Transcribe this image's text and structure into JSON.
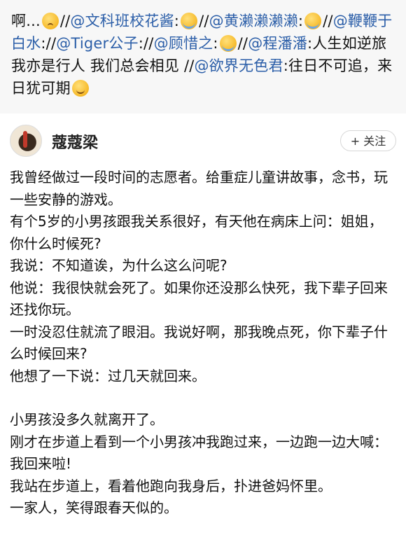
{
  "repost": {
    "prefix": "啊...",
    "segments": [
      {
        "type": "emoji",
        "name": "sad-emoji"
      },
      {
        "type": "text",
        "text": "//"
      },
      {
        "type": "mention",
        "text": "@文科班校花酱"
      },
      {
        "type": "text",
        "text": ":"
      },
      {
        "type": "emoji",
        "name": "crying-emoji"
      },
      {
        "type": "text",
        "text": "//"
      },
      {
        "type": "mention",
        "text": "@黄濑濑濑濑"
      },
      {
        "type": "text",
        "text": ":"
      },
      {
        "type": "emoji",
        "name": "crying-emoji"
      },
      {
        "type": "text",
        "text": "//"
      },
      {
        "type": "mention",
        "text": "@鞭鞭于白水"
      },
      {
        "type": "text",
        "text": "://"
      },
      {
        "type": "mention",
        "text": "@Tiger公子"
      },
      {
        "type": "text",
        "text": "://"
      },
      {
        "type": "mention",
        "text": "@顾惜之"
      },
      {
        "type": "text",
        "text": ":"
      },
      {
        "type": "emoji",
        "name": "crying-emoji"
      },
      {
        "type": "text",
        "text": "//"
      },
      {
        "type": "mention",
        "text": "@程潘潘"
      },
      {
        "type": "text",
        "text": ":人生如逆旅 我亦是行人 我们总会相见 //"
      },
      {
        "type": "mention",
        "text": "@欲界无色君"
      },
      {
        "type": "text",
        "text": ":往日不可追，来日犹可期"
      },
      {
        "type": "emoji",
        "name": "smile-emoji"
      }
    ]
  },
  "post": {
    "username": "蔻蔻梁",
    "follow_label": "+ 关注",
    "paragraphs": [
      "我曾经做过一段时间的志愿者。给重症儿童讲故事，念书，玩一些安静的游戏。",
      "有个5岁的小男孩跟我关系很好，有天他在病床上问：姐姐，你什么时候死?",
      "我说：不知道诶，为什么这么问呢?",
      "他说：我很快就会死了。如果你还没那么快死，我下辈子回来还找你玩。",
      "一时没忍住就流了眼泪。我说好啊，那我晚点死，你下辈子什么时候回来?",
      "他想了一下说：过几天就回来。",
      "",
      "小男孩没多久就离开了。",
      "刚才在步道上看到一个小男孩冲我跑过来，一边跑一边大喊：我回来啦!",
      "我站在步道上，看着他跑向我身后，扑进爸妈怀里。",
      "一家人，笑得跟春天似的。"
    ]
  },
  "colors": {
    "mention": "#2b5ea8",
    "background": "#f7f7f7",
    "card": "#ffffff"
  }
}
